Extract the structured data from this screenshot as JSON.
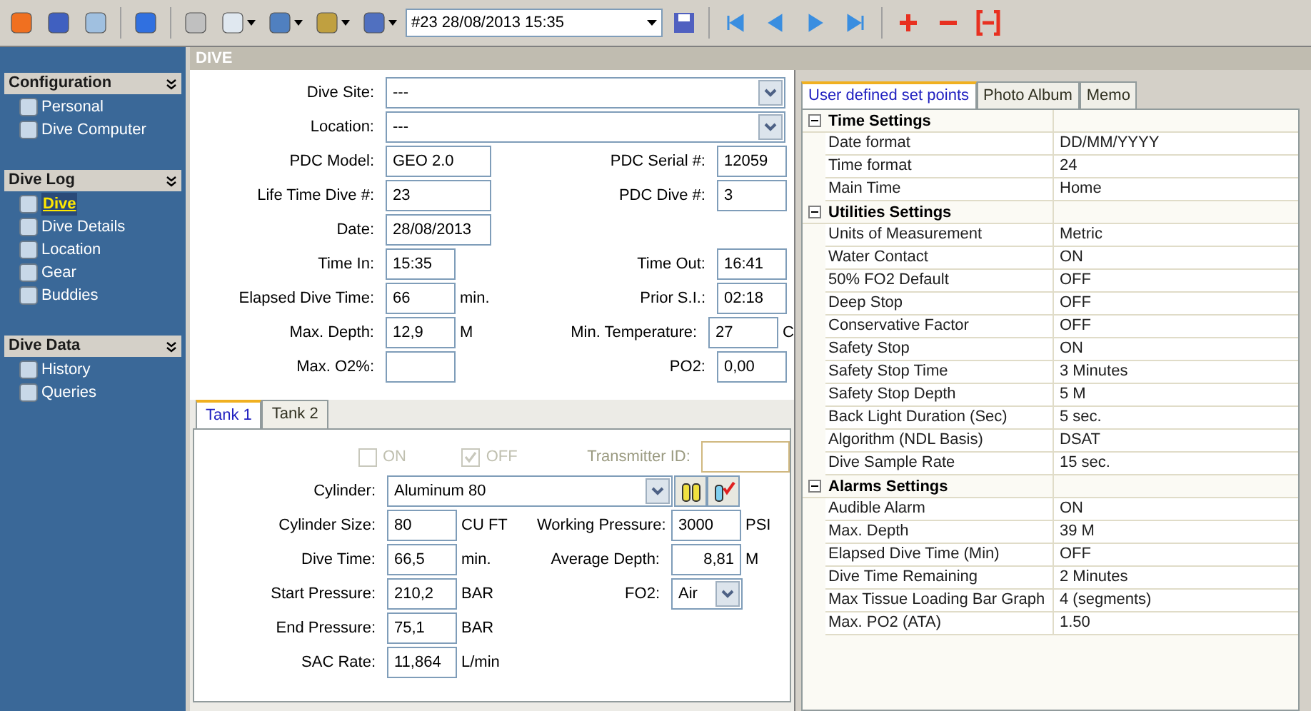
{
  "toolbar": {
    "record_select": "#23 28/08/2013 15:35"
  },
  "sidebar": {
    "sections": [
      {
        "title": "Configuration",
        "items": [
          {
            "label": "Personal",
            "selected": false
          },
          {
            "label": "Dive Computer",
            "selected": false
          }
        ]
      },
      {
        "title": "Dive Log",
        "items": [
          {
            "label": "Dive",
            "selected": true
          },
          {
            "label": "Dive Details",
            "selected": false
          },
          {
            "label": "Location",
            "selected": false
          },
          {
            "label": "Gear",
            "selected": false
          },
          {
            "label": "Buddies",
            "selected": false
          }
        ]
      },
      {
        "title": "Dive Data",
        "items": [
          {
            "label": "History",
            "selected": false
          },
          {
            "label": "Queries",
            "selected": false
          }
        ]
      }
    ]
  },
  "page_title": "DIVE",
  "dive_form": {
    "combos": [
      {
        "label": "Dive Site:",
        "value": "---"
      },
      {
        "label": "Location:",
        "value": "---"
      }
    ],
    "rows": [
      {
        "left": {
          "label": "PDC Model:",
          "value": "GEO 2.0",
          "wide": true
        },
        "right": {
          "label": "PDC Serial #:",
          "value": "12059"
        }
      },
      {
        "left": {
          "label": "Life Time Dive #:",
          "value": "23",
          "wide": true
        },
        "right": {
          "label": "PDC Dive #:",
          "value": "3"
        }
      },
      {
        "left": {
          "label": "Date:",
          "value": "28/08/2013",
          "wide": true
        }
      },
      {
        "left": {
          "label": "Time In:",
          "value": "15:35"
        },
        "right": {
          "label": "Time Out:",
          "value": "16:41"
        }
      },
      {
        "left": {
          "label": "Elapsed Dive Time:",
          "value": "66",
          "unit": "min."
        },
        "right": {
          "label": "Prior S.I.:",
          "value": "02:18"
        }
      },
      {
        "left": {
          "label": "Max. Depth:",
          "value": "12,9",
          "unit": "M"
        },
        "right": {
          "label": "Min. Temperature:",
          "value": "27",
          "unit": "C"
        }
      },
      {
        "left": {
          "label": "Max. O2%:"
        },
        "right": {
          "label": "PO2:",
          "value": "0,00"
        }
      }
    ]
  },
  "tank": {
    "tabs": [
      {
        "label": "Tank 1",
        "selected": true
      },
      {
        "label": "Tank 2",
        "selected": false
      }
    ],
    "checkboxes": [
      {
        "label": "ON",
        "checked": false,
        "disabled": true
      },
      {
        "label": "OFF",
        "checked": true,
        "disabled": true
      }
    ],
    "transmitter_label": "Transmitter ID:",
    "cylinder": {
      "label": "Cylinder:",
      "value": "Aluminum 80"
    },
    "rows": [
      {
        "left": {
          "label": "Cylinder Size:",
          "value": "80",
          "unit": "CU FT"
        },
        "right": {
          "label": "Working Pressure:",
          "value": "3000",
          "unit": "PSI"
        }
      },
      {
        "left": {
          "label": "Dive Time:",
          "value": "66,5",
          "unit": "min."
        },
        "right": {
          "label": "Average Depth:",
          "value": "8,81",
          "unit": "M",
          "right_aligned": true
        }
      },
      {
        "left": {
          "label": "Start Pressure:",
          "value": "210,2",
          "unit": "BAR"
        },
        "right": {
          "label": "FO2:",
          "value": "Air",
          "kind": "combo"
        }
      },
      {
        "left": {
          "label": "End Pressure:",
          "value": "75,1",
          "unit": "BAR"
        }
      },
      {
        "left": {
          "label": "SAC Rate:",
          "value": "11,864",
          "unit": "L/min"
        }
      }
    ]
  },
  "settings": {
    "tabs": [
      {
        "label": "User defined set points",
        "selected": true
      },
      {
        "label": "Photo Album",
        "selected": false
      },
      {
        "label": "Memo",
        "selected": false
      }
    ],
    "groups": [
      {
        "title": "Time Settings",
        "expanded": true,
        "rows": [
          [
            "Date format",
            "DD/MM/YYYY"
          ],
          [
            "Time format",
            "24"
          ],
          [
            "Main Time",
            "Home"
          ]
        ]
      },
      {
        "title": "Utilities Settings",
        "expanded": true,
        "rows": [
          [
            "Units of Measurement",
            "Metric"
          ],
          [
            "Water Contact",
            "ON"
          ],
          [
            "50% FO2 Default",
            "OFF"
          ],
          [
            "Deep Stop",
            "OFF"
          ],
          [
            "Conservative Factor",
            "OFF"
          ],
          [
            "Safety Stop",
            "ON"
          ],
          [
            "Safety Stop Time",
            "3 Minutes"
          ],
          [
            "Safety Stop Depth",
            "5 M"
          ],
          [
            "Back Light Duration (Sec)",
            "5 sec."
          ],
          [
            "Algorithm (NDL Basis)",
            "DSAT"
          ],
          [
            "Dive Sample Rate",
            "15 sec."
          ]
        ]
      },
      {
        "title": "Alarms Settings",
        "expanded": true,
        "rows": [
          [
            "Audible Alarm",
            "ON"
          ],
          [
            "Max. Depth",
            "39 M"
          ],
          [
            "Elapsed Dive Time (Min)",
            "OFF"
          ],
          [
            "Dive Time Remaining",
            "2 Minutes"
          ],
          [
            "Max Tissue Loading Bar Graph",
            "4 (segments)"
          ],
          [
            "Max. PO2 (ATA)",
            "1.50"
          ]
        ]
      }
    ]
  }
}
